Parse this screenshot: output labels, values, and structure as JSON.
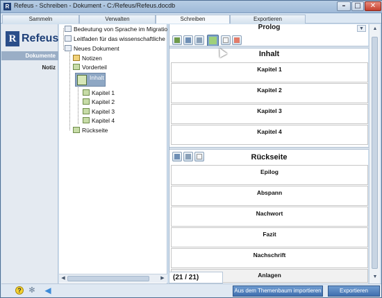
{
  "window": {
    "title": "Refeus - Schreiben - Dokument - C:/Refeus/Refeus.docdb"
  },
  "tabs": [
    {
      "label": "Sammeln"
    },
    {
      "label": "Verwalten"
    },
    {
      "label": "Schreiben",
      "active": true
    },
    {
      "label": "Exportieren"
    }
  ],
  "rail": {
    "logo_mark": "R",
    "logo_text": "Refeus",
    "items": [
      {
        "label": "Dokumente",
        "active": true
      },
      {
        "label": "Notiz",
        "active": false
      }
    ]
  },
  "tree": {
    "items": [
      {
        "label": "Bedeutung von Sprache im Migratio"
      },
      {
        "label": "Leitfaden für das wissenschaftliche"
      },
      {
        "label": "Neues Dokument"
      },
      {
        "label": "Notizen"
      },
      {
        "label": "Vorderteil"
      },
      {
        "label": "Inhalt",
        "selected": true
      },
      {
        "label": "Kapitel 1"
      },
      {
        "label": "Kapitel 2"
      },
      {
        "label": "Kapitel 3"
      },
      {
        "label": "Kapitel 4"
      },
      {
        "label": "Rückseite"
      }
    ]
  },
  "editor": {
    "front_section": {
      "last_row": "Prolog"
    },
    "content_section": {
      "title": "Inhalt",
      "rows": [
        "Kapitel 1",
        "Kapitel 2",
        "Kapitel 3",
        "Kapitel 4"
      ]
    },
    "back_section": {
      "title": "Rückseite",
      "rows": [
        "Epilog",
        "Abspann",
        "Nachwort",
        "Fazit",
        "Nachschrift",
        "Anlagen"
      ]
    },
    "counter": "(21 / 21)"
  },
  "footer": {
    "help_label": "?",
    "import_button": "Aus dem Themenbaum importieren",
    "export_button": "Exportieren"
  },
  "colors": {
    "accent": "#3f6fae",
    "selection": "#8ea7c4",
    "panel": "#cfe0f0"
  }
}
